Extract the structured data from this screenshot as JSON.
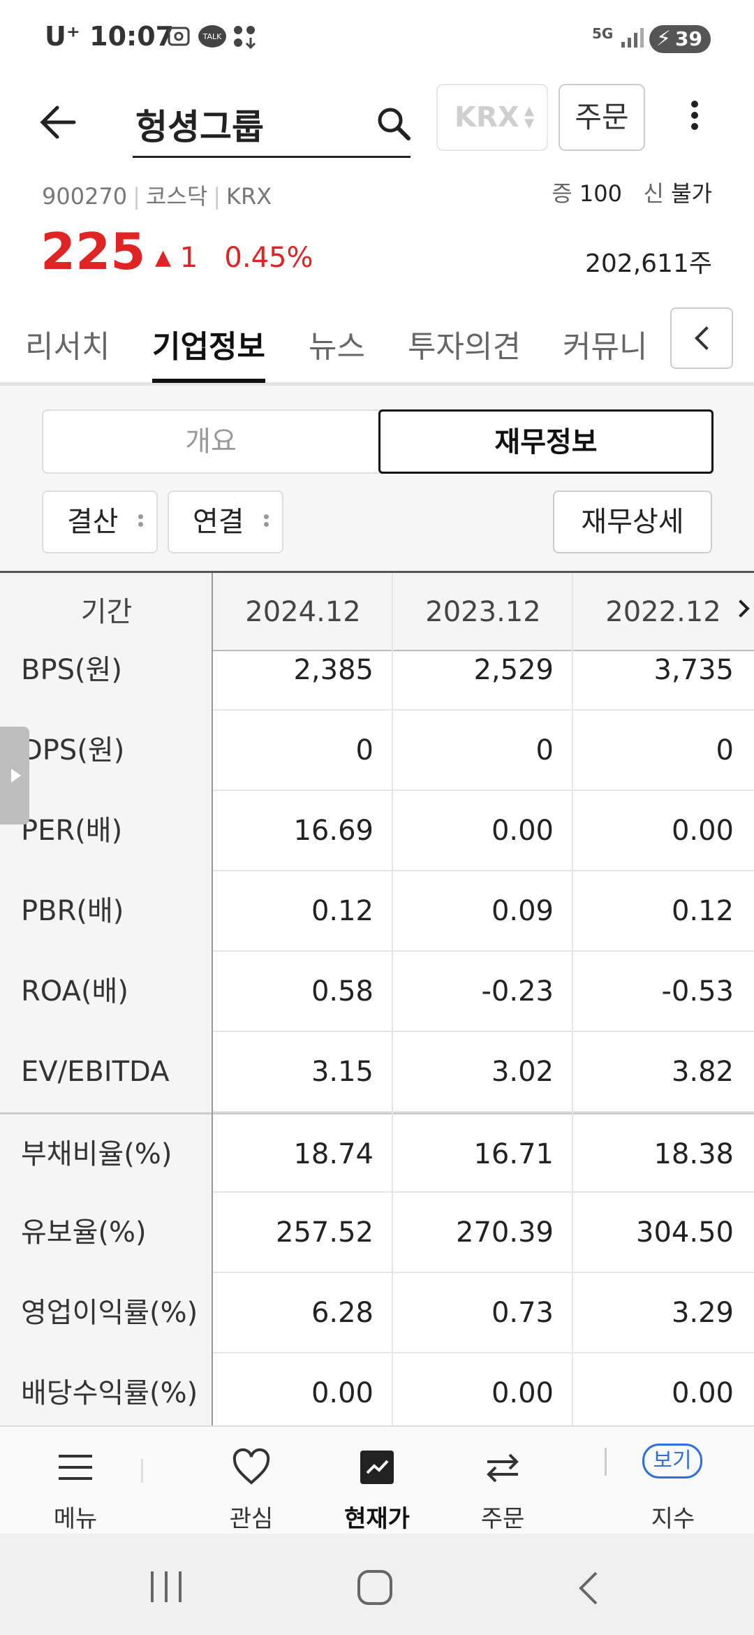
{
  "status": {
    "carrier": "U⁺",
    "time": "10:07",
    "network": "5G",
    "battery": "39",
    "talk": "TALK"
  },
  "header": {
    "title": "헝셩그룹",
    "exchange": "KRX",
    "order_label": "주문"
  },
  "stock": {
    "code": "900270",
    "market": "코스닥",
    "exchange": "KRX",
    "margin_label": "증",
    "margin_value": "100",
    "credit_label": "신",
    "credit_value": "불가",
    "price": "225",
    "change": "1",
    "change_pct": "0.45%",
    "volume": "202,611주",
    "up_color": "#e02424"
  },
  "tabs": [
    "리서치",
    "기업정보",
    "뉴스",
    "투자의견",
    "커뮤니"
  ],
  "segment": {
    "overview": "개요",
    "financial": "재무정보"
  },
  "filters": {
    "period": "결산",
    "scope": "연결",
    "detail": "재무상세"
  },
  "table": {
    "header": [
      "기간",
      "2024.12",
      "2023.12",
      "2022.12"
    ],
    "rows": [
      {
        "label": "BPS(원)",
        "values": [
          "2,385",
          "2,529",
          "3,735"
        ]
      },
      {
        "label": "DPS(원)",
        "values": [
          "0",
          "0",
          "0"
        ]
      },
      {
        "label": "PER(배)",
        "values": [
          "16.69",
          "0.00",
          "0.00"
        ]
      },
      {
        "label": "PBR(배)",
        "values": [
          "0.12",
          "0.09",
          "0.12"
        ]
      },
      {
        "label": "ROA(배)",
        "values": [
          "0.58",
          "-0.23",
          "-0.53"
        ]
      },
      {
        "label": "EV/EBITDA",
        "values": [
          "3.15",
          "3.02",
          "3.82"
        ]
      },
      {
        "label": "부채비율(%)",
        "values": [
          "18.74",
          "16.71",
          "18.38"
        ]
      },
      {
        "label": "유보율(%)",
        "values": [
          "257.52",
          "270.39",
          "304.50"
        ]
      },
      {
        "label": "영업이익률(%)",
        "values": [
          "6.28",
          "0.73",
          "3.29"
        ]
      },
      {
        "label": "배당수익률(%)",
        "values": [
          "0.00",
          "0.00",
          "0.00"
        ]
      }
    ]
  },
  "bottom_nav": {
    "menu": "메뉴",
    "watch": "관심",
    "current": "현재가",
    "order": "주문",
    "index": "지수",
    "index_badge": "보기"
  }
}
